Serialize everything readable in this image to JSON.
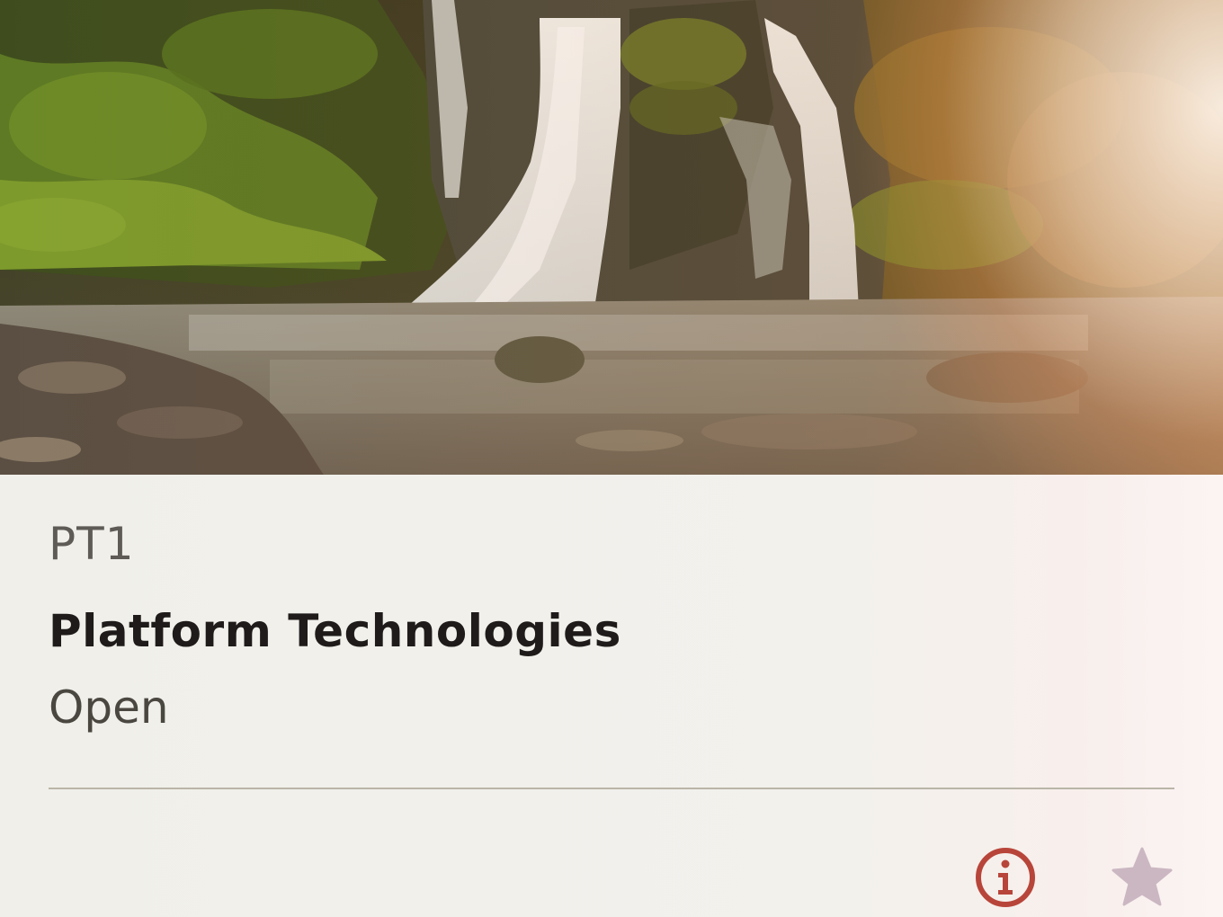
{
  "card": {
    "code": "PT1",
    "title": "Platform Technologies",
    "status": "Open",
    "image_subject": "waterfall-in-forest",
    "accent_color": "#b8453a",
    "favorite_color": "#cbb7c2"
  },
  "actions": {
    "info_icon": "info-icon",
    "favorite_icon": "star-icon"
  }
}
